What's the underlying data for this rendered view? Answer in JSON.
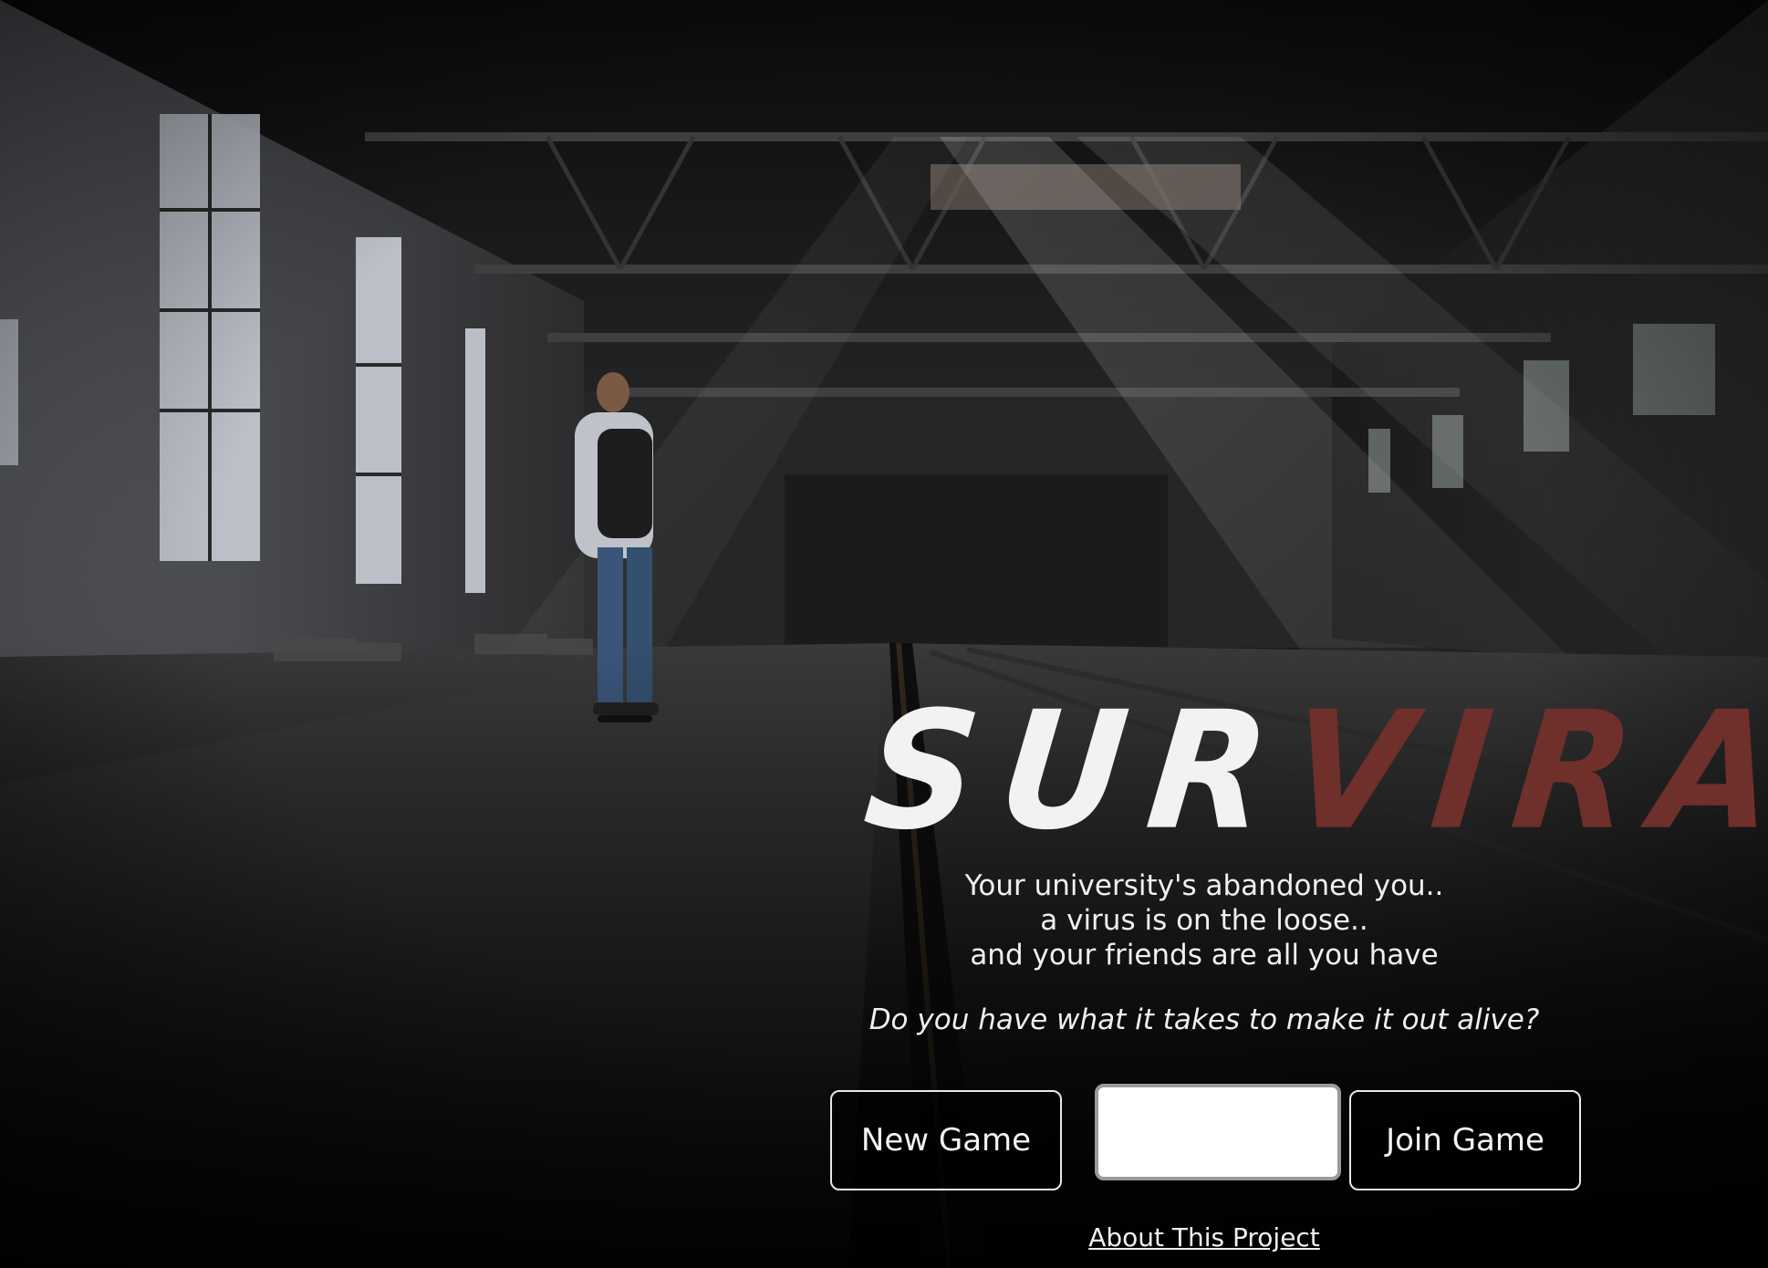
{
  "game": {
    "title_part1": "SUR",
    "title_part2": "VIRAL",
    "tagline": [
      "Your university's abandoned you..",
      "a virus is on the loose..",
      "and your friends are all you have"
    ],
    "question": "Do you have what it takes to make it out alive?"
  },
  "actions": {
    "new_game_label": "New Game",
    "game_code_value": "",
    "join_game_label": "Join Game",
    "about_label": "About This Project"
  },
  "colors": {
    "title_primary": "#f2f2f2",
    "title_accent": "#6f2f2a",
    "text": "#f0f0f0",
    "button_border": "#e8e8e8"
  },
  "background": {
    "scene": "abandoned industrial hall with person on skateboard"
  }
}
